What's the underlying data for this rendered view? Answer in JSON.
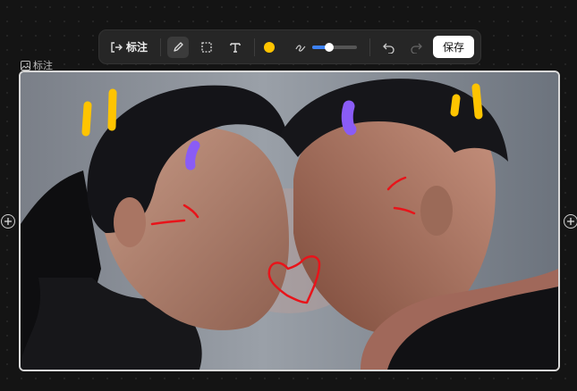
{
  "toolbar": {
    "annotate_label": "标注",
    "brush_color": "#FFC400",
    "brush_size_fraction": 0.38,
    "save_label": "保存"
  },
  "frame": {
    "label": "标注"
  },
  "annotations": {
    "colors": {
      "yellow": "#FFC400",
      "purple": "#8A5CF6",
      "red": "#E8141A"
    }
  },
  "icons": [
    "exit-annotate-icon",
    "brush-icon",
    "select-rect-icon",
    "text-icon",
    "stroke-width-icon",
    "undo-icon",
    "redo-icon",
    "image-icon",
    "add-left-icon",
    "add-right-icon"
  ]
}
